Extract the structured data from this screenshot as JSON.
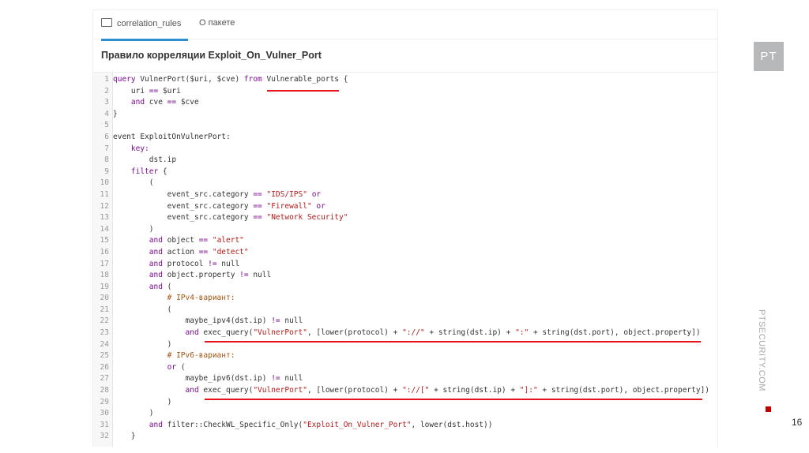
{
  "tabs": [
    {
      "label": "correlation_rules",
      "icon": "folder-icon"
    },
    {
      "label": "О пакете"
    }
  ],
  "title": "Правило корреляции Exploit_On_Vulner_Port",
  "code": [
    [
      [
        "k",
        "query"
      ],
      [
        "p",
        " VulnerPort($uri, $cve) "
      ],
      [
        "k",
        "from"
      ],
      [
        "p",
        " Vulnerable_ports {"
      ]
    ],
    [
      [
        "p",
        "    uri "
      ],
      [
        "o",
        "=="
      ],
      [
        "p",
        " $uri"
      ]
    ],
    [
      [
        "k",
        "    and"
      ],
      [
        "p",
        " cve "
      ],
      [
        "o",
        "=="
      ],
      [
        "p",
        " $cve"
      ]
    ],
    [
      [
        "p",
        "}"
      ]
    ],
    [
      [
        "p",
        ""
      ]
    ],
    [
      [
        "p",
        "event ExploitOnVulnerPort:"
      ]
    ],
    [
      [
        "k",
        "    key:"
      ]
    ],
    [
      [
        "p",
        "        dst.ip"
      ]
    ],
    [
      [
        "k",
        "    filter"
      ],
      [
        "p",
        " {"
      ]
    ],
    [
      [
        "p",
        "        ("
      ]
    ],
    [
      [
        "p",
        "            event_src.category "
      ],
      [
        "o",
        "=="
      ],
      [
        "s",
        " \"IDS/IPS\""
      ],
      [
        "k",
        " or"
      ]
    ],
    [
      [
        "p",
        "            event_src.category "
      ],
      [
        "o",
        "=="
      ],
      [
        "s",
        " \"Firewall\""
      ],
      [
        "k",
        " or"
      ]
    ],
    [
      [
        "p",
        "            event_src.category "
      ],
      [
        "o",
        "=="
      ],
      [
        "s",
        " \"Network Security\""
      ]
    ],
    [
      [
        "p",
        "        )"
      ]
    ],
    [
      [
        "k",
        "        and"
      ],
      [
        "p",
        " object "
      ],
      [
        "o",
        "=="
      ],
      [
        "s",
        " \"alert\""
      ]
    ],
    [
      [
        "k",
        "        and"
      ],
      [
        "p",
        " action "
      ],
      [
        "o",
        "=="
      ],
      [
        "s",
        " \"detect\""
      ]
    ],
    [
      [
        "k",
        "        and"
      ],
      [
        "p",
        " protocol "
      ],
      [
        "o",
        "!="
      ],
      [
        "p",
        " null"
      ]
    ],
    [
      [
        "k",
        "        and"
      ],
      [
        "p",
        " object.property "
      ],
      [
        "o",
        "!="
      ],
      [
        "p",
        " null"
      ]
    ],
    [
      [
        "k",
        "        and"
      ],
      [
        "p",
        " ("
      ]
    ],
    [
      [
        "c",
        "            # IPv4-вариант:"
      ]
    ],
    [
      [
        "p",
        "            ("
      ]
    ],
    [
      [
        "p",
        "                maybe_ipv4(dst.ip) "
      ],
      [
        "o",
        "!="
      ],
      [
        "p",
        " null"
      ]
    ],
    [
      [
        "k",
        "                and"
      ],
      [
        "p",
        " exec_query("
      ],
      [
        "s",
        "\"VulnerPort\""
      ],
      [
        "p",
        ", [lower(protocol) + "
      ],
      [
        "s",
        "\"://\""
      ],
      [
        "p",
        " + string(dst.ip) + "
      ],
      [
        "s",
        "\":\""
      ],
      [
        "p",
        " + string(dst.port), object.property])"
      ]
    ],
    [
      [
        "p",
        "            )"
      ]
    ],
    [
      [
        "c",
        "            # IPv6-вариант:"
      ]
    ],
    [
      [
        "k",
        "            or"
      ],
      [
        "p",
        " ("
      ]
    ],
    [
      [
        "p",
        "                maybe_ipv6(dst.ip) "
      ],
      [
        "o",
        "!="
      ],
      [
        "p",
        " null"
      ]
    ],
    [
      [
        "k",
        "                and"
      ],
      [
        "p",
        " exec_query("
      ],
      [
        "s",
        "\"VulnerPort\""
      ],
      [
        "p",
        ", [lower(protocol) + "
      ],
      [
        "s",
        "\"://[\""
      ],
      [
        "p",
        " + string(dst.ip) + "
      ],
      [
        "s",
        "\"]:\""
      ],
      [
        "p",
        " + string(dst.port), object.property])"
      ]
    ],
    [
      [
        "p",
        "            )"
      ]
    ],
    [
      [
        "p",
        "        )"
      ]
    ],
    [
      [
        "k",
        "        and"
      ],
      [
        "p",
        " filter::CheckWL_Specific_Only("
      ],
      [
        "s",
        "\"Exploit_On_Vulner_Port\""
      ],
      [
        "p",
        ", lower(dst.host))"
      ]
    ],
    [
      [
        "p",
        "    }"
      ]
    ]
  ],
  "brand": {
    "logo": "PT",
    "site": "PTSECURITY.COM",
    "accent": "#c00000"
  },
  "page_number": "16"
}
